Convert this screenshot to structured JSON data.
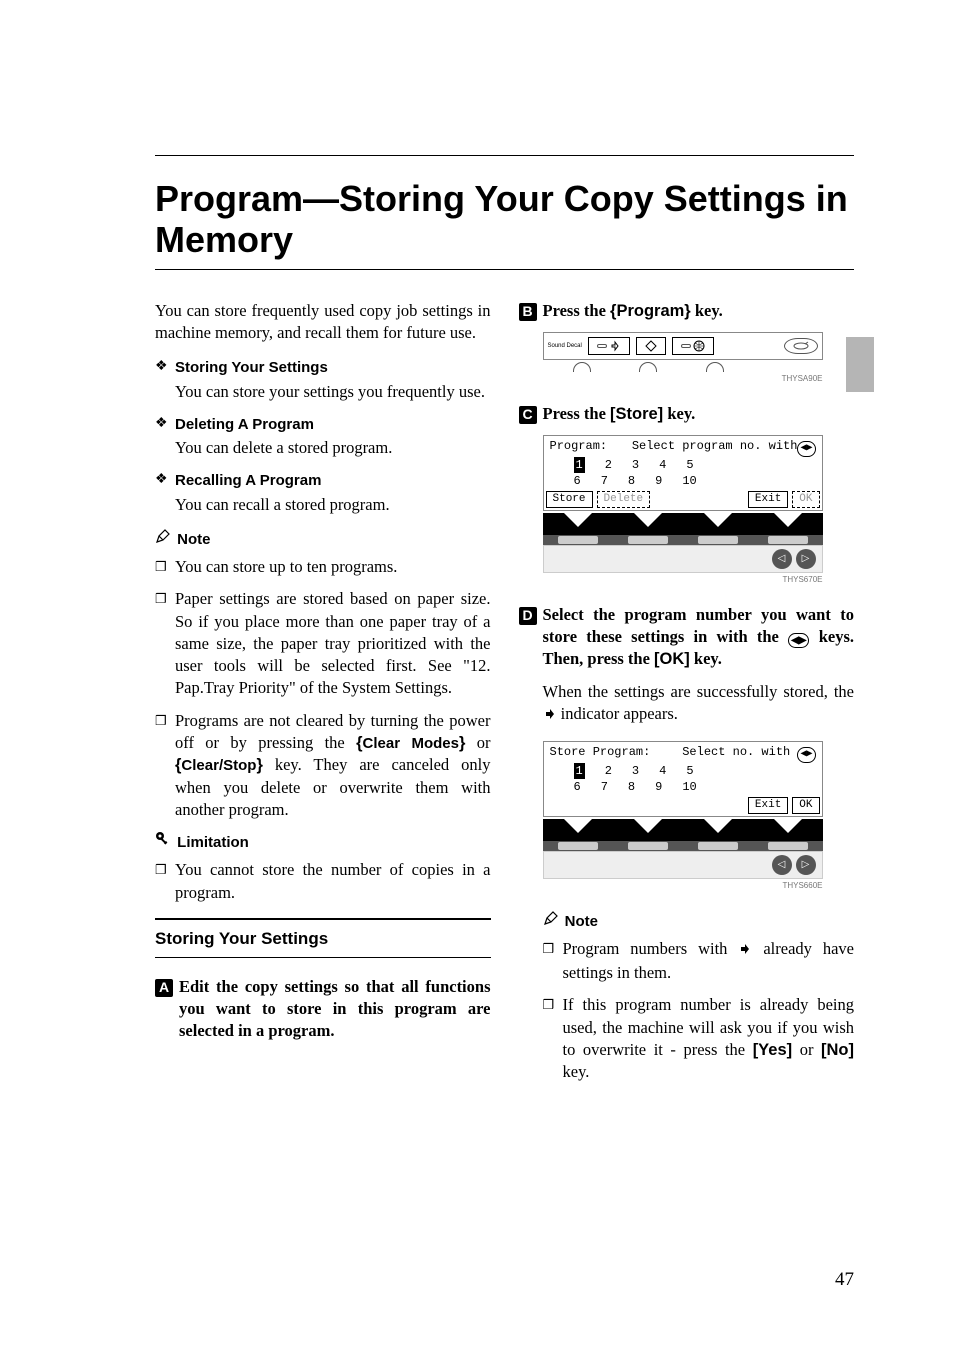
{
  "title": "Program—Storing Your Copy Settings in Memory",
  "intro": "You can store frequently used copy job settings in machine memory, and recall them for future use.",
  "functions": [
    {
      "label": "Storing Your Settings",
      "text": "You can store your settings you frequently use."
    },
    {
      "label": "Deleting A Program",
      "text": "You can delete a stored program."
    },
    {
      "label": "Recalling A Program",
      "text": "You can recall a stored program."
    }
  ],
  "note_head": "Note",
  "notes_left": [
    "You can store up to ten programs.",
    "Paper settings are stored based on paper size. So if you place more than one paper tray of a same size, the paper tray prioritized with the user tools will be selected first. See \"12. Pap.Tray Priority\" of the System Settings.",
    "Programs are not cleared by turning the power off or by pressing the {Clear Modes} or {Clear/Stop} key. They are canceled only when you delete or overwrite them with another program."
  ],
  "note3_pre": "Programs are not cleared by turning the power off or by pressing the ",
  "note3_key1": "Clear Modes",
  "note3_mid": " or ",
  "note3_key2": "Clear/Stop",
  "note3_post": " key. They are canceled only when you delete or overwrite them with another program.",
  "limit_head": "Limitation",
  "limit_text": "You cannot store the number of copies in a program.",
  "subhead": "Storing Your Settings",
  "steps": {
    "s1": "Edit the copy settings so that all functions you want to store in this program are selected in a program.",
    "s2_pre": "Press the ",
    "s2_key": "Program",
    "s2_post": " key.",
    "s3_pre": "Press the ",
    "s3_key": "[Store]",
    "s3_post": " key.",
    "s4_pre": "Select the program number you want to store these settings in with the ",
    "s4_post": " keys. Then, press the ",
    "s4_key": "[OK]",
    "s4_end": " key.",
    "s4_result": "When the settings are successfully stored, the  indicator appears.",
    "s4_result_pre": "When the settings are successfully stored, the ",
    "s4_result_post": " indicator appears."
  },
  "notes_right": [
    "Program numbers with  already have settings in them.",
    "If this program number is already being used, the machine will ask you if you wish to overwrite it - press the [Yes] or [No] key."
  ],
  "nr1_pre": "Program numbers with ",
  "nr1_post": " already have settings in them.",
  "nr2_pre": "If this program number is already being used, the machine will ask you if you wish to overwrite it - press the ",
  "nr2_yes": "[Yes]",
  "nr2_mid": " or ",
  "nr2_no": "[No]",
  "nr2_post": " key.",
  "lcd1": {
    "header_left": "Program:",
    "header_right": "Select program no. with",
    "row1": [
      "1",
      "2",
      "3",
      "4",
      "5"
    ],
    "row2": [
      "6",
      "7",
      "8",
      "9",
      "10"
    ],
    "btns": [
      "Store",
      "Delete",
      "Exit",
      "OK"
    ]
  },
  "lcd2": {
    "header_left": "Store Program:",
    "header_right": "Select no. with",
    "row1": [
      "1",
      "2",
      "3",
      "4",
      "5"
    ],
    "row2": [
      "6",
      "7",
      "8",
      "9",
      "10"
    ],
    "btns": [
      "Exit",
      "OK"
    ]
  },
  "figcodes": {
    "panel": "THYSA90E",
    "kp1": "THYS670E",
    "kp2": "THYS660E"
  },
  "ctrl_label": "Sound Decal",
  "page_num": "47"
}
